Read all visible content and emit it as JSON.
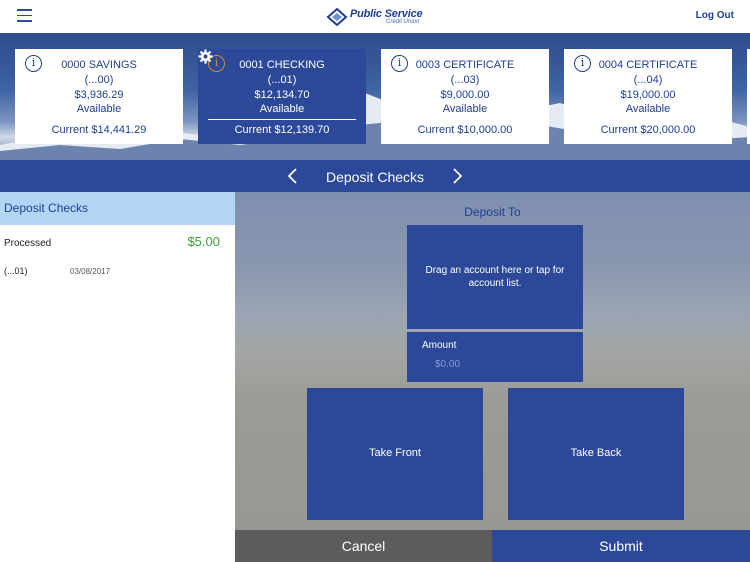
{
  "header": {
    "logo_title": "Public Service",
    "logo_subtitle": "Credit Union",
    "logout_label": "Log Out"
  },
  "accounts": [
    {
      "name": "0000 SAVINGS",
      "mask": "(...00)",
      "available": "$3,936.29",
      "available_label": "Available",
      "current": "Current $14,441.29",
      "selected": false
    },
    {
      "name": "0001 CHECKING",
      "mask": "(...01)",
      "available": "$12,134.70",
      "available_label": "Available",
      "current": "Current $12,139.70",
      "selected": true
    },
    {
      "name": "0003 CERTIFICATE",
      "mask": "(...03)",
      "available": "$9,000.00",
      "available_label": "Available",
      "current": "Current $10,000.00",
      "selected": false
    },
    {
      "name": "0004 CERTIFICATE",
      "mask": "(...04)",
      "available": "$19,000.00",
      "available_label": "Available",
      "current": "Current $20,000.00",
      "selected": false
    }
  ],
  "title_bar": {
    "title": "Deposit Checks"
  },
  "history": {
    "header": "Deposit Checks",
    "items": [
      {
        "status": "Processed",
        "amount": "$5.00",
        "account": "(...01)",
        "date": "03/08/2017"
      }
    ]
  },
  "deposit": {
    "deposit_to_label": "Deposit To",
    "drop_hint": "Drag an account here or tap for account list.",
    "amount_label": "Amount",
    "amount_placeholder": "$0.00",
    "take_front_label": "Take Front",
    "take_back_label": "Take Back"
  },
  "footer": {
    "cancel_label": "Cancel",
    "submit_label": "Submit"
  },
  "icons": {
    "menu": "hamburger-icon",
    "info": "info-icon",
    "settings": "gear-icon",
    "prev": "chevron-left-icon",
    "next": "chevron-right-icon"
  },
  "colors": {
    "brand_blue": "#2b4899",
    "light_blue_header": "#b3d5f5",
    "amount_green": "#3aa23a",
    "cancel_gray": "#5c5c5c",
    "info_icon_selected": "#d98a2b"
  }
}
